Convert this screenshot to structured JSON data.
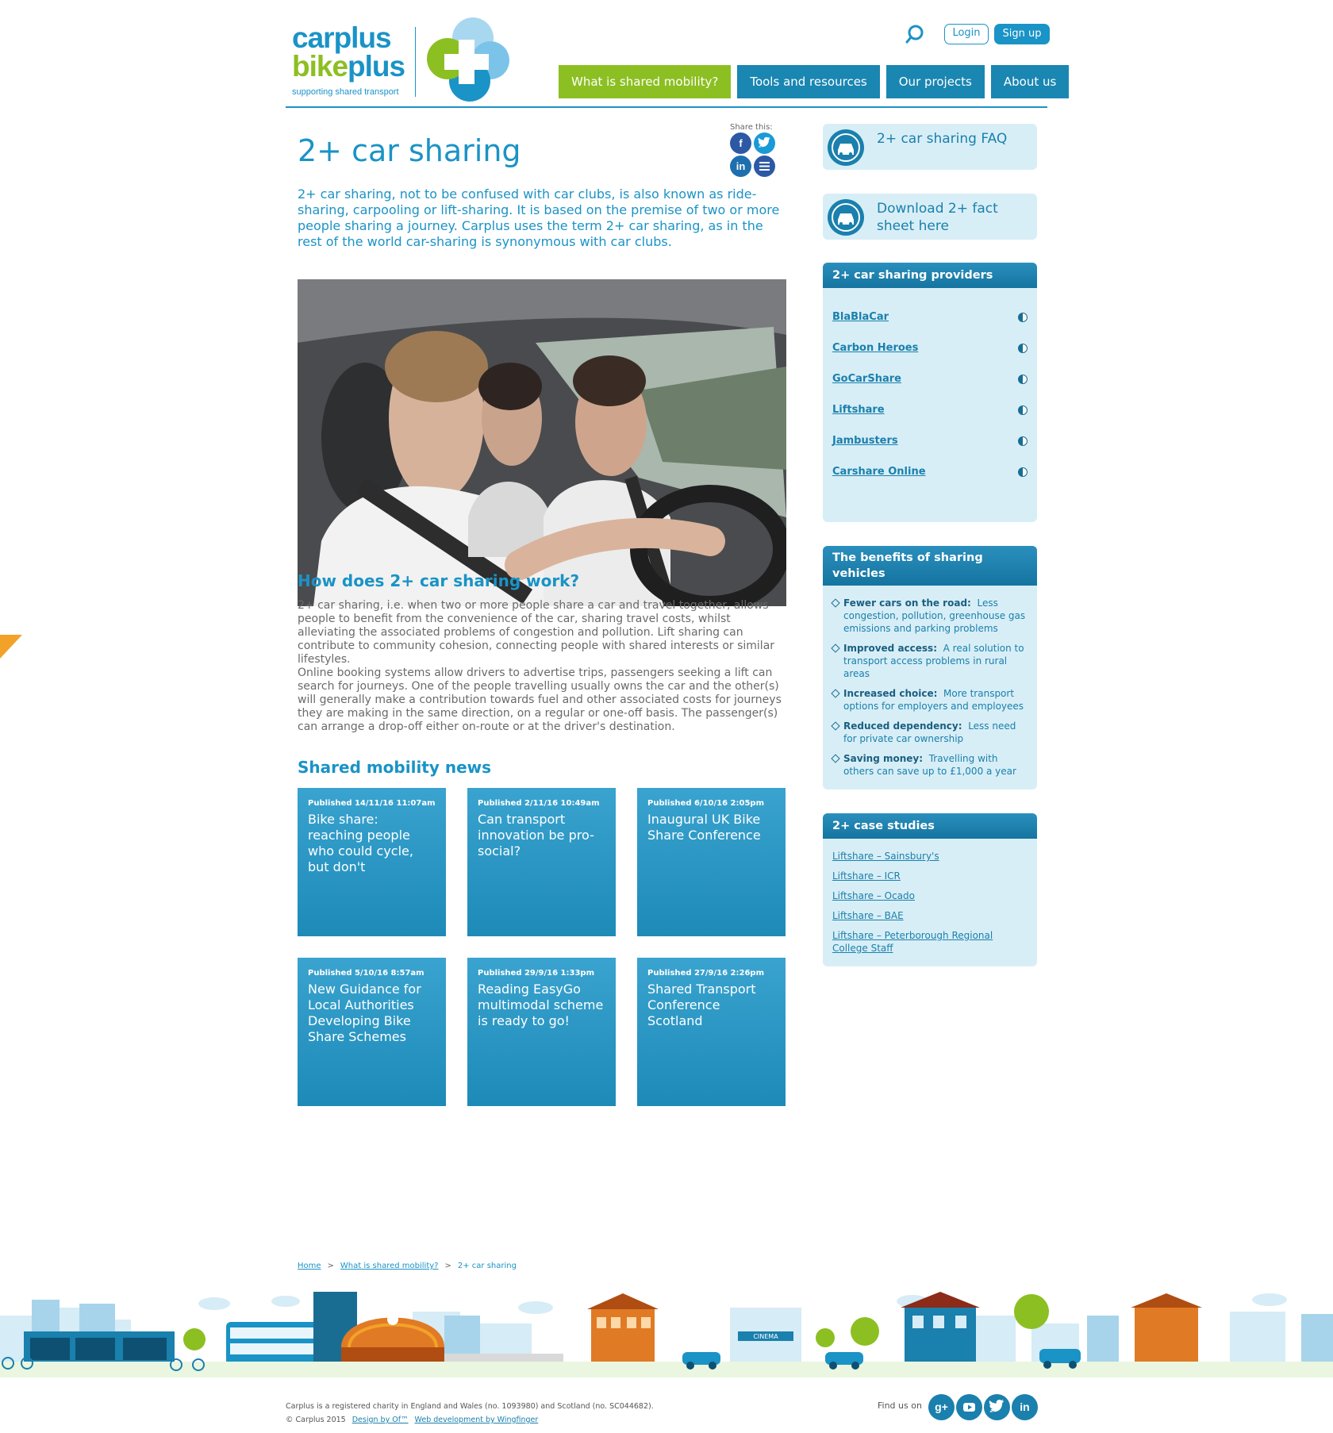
{
  "header": {
    "logo_line1_a": "car",
    "logo_line1_b": "plus",
    "logo_line2_a": "bike",
    "logo_line2_b": "plus",
    "logo_tagline": "supporting shared transport",
    "login_label": "Login",
    "signup_label": "Sign up",
    "nav": [
      "What is shared mobility?",
      "Tools and resources",
      "Our projects",
      "About us"
    ]
  },
  "main": {
    "title": "2+ car sharing",
    "share_label": "Share this:",
    "intro": "2+ car sharing, not to be confused with car clubs, is also known as ride-sharing, carpooling or lift-sharing. It is based on the premise of two or more people sharing a journey. Carplus uses the term 2+ car sharing, as in the rest of the world car-sharing is synonymous with car clubs.",
    "how_heading": "How does 2+ car sharing work?",
    "how_p1": "2+ car sharing, i.e. when two or more people share a car and travel together, allows people to benefit from the convenience of the car, sharing travel costs, whilst alleviating the associated problems of congestion and pollution. Lift sharing can contribute to community cohesion, connecting people with shared interests or similar lifestyles.",
    "how_p2": "Online booking systems allow drivers to advertise trips, passengers seeking a lift can search for journeys. One of the people travelling usually owns the car and the other(s) will generally make a contribution towards fuel and other associated costs for journeys they are making in the same direction, on a regular or one-off basis. The passenger(s) can arrange a drop-off either on-route or at the driver's destination.",
    "news_heading": "Shared mobility news",
    "news": [
      {
        "date": "Published 14/11/16  11:07am",
        "title": "Bike share: reaching people who could cycle, but don't"
      },
      {
        "date": "Published 2/11/16  10:49am",
        "title": "Can transport innovation be pro-social?"
      },
      {
        "date": "Published 6/10/16  2:05pm",
        "title": "Inaugural UK Bike Share Conference"
      },
      {
        "date": "Published 5/10/16  8:57am",
        "title": "New Guidance for Local Authorities Developing Bike Share Schemes"
      },
      {
        "date": "Published 29/9/16  1:33pm",
        "title": "Reading EasyGo multimodal scheme is ready to go!"
      },
      {
        "date": "Published 27/9/16  2:26pm",
        "title": "Shared Transport Conference Scotland"
      }
    ],
    "breadcrumb": [
      "Home",
      "What is shared mobility?",
      "2+ car sharing"
    ],
    "breadcrumb_sep": ">"
  },
  "sidebar": {
    "faq_label": "2+ car sharing FAQ",
    "download_label": "Download 2+ fact sheet here",
    "providers_heading": "2+ car sharing providers",
    "providers": [
      "BlaBlaCar",
      "Carbon Heroes",
      "GoCarShare",
      "Liftshare",
      "Jambusters",
      "Carshare Online"
    ],
    "benefits_heading": "The benefits of sharing vehicles",
    "benefits": [
      {
        "title": "Fewer cars on the road:",
        "text": "Less congestion, pollution, greenhouse gas emissions and parking problems"
      },
      {
        "title": "Improved access:",
        "text": "A real solution to transport access problems in rural areas"
      },
      {
        "title": "Increased choice:",
        "text": "More transport options for employers and employees"
      },
      {
        "title": "Reduced dependency:",
        "text": "Less need for private car ownership"
      },
      {
        "title": "Saving money:",
        "text": "Travelling with others can save up to £1,000 a year"
      }
    ],
    "case_heading": "2+ case studies",
    "cases": [
      "Liftshare – Sainsbury's",
      "Liftshare – ICR",
      "Liftshare – Ocado",
      "Liftshare – BAE",
      "Liftshare – Peterborough Regional College Staff"
    ]
  },
  "footer": {
    "legal": "Carplus is a registered charity in England and Wales (no. 1093980) and Scotland (no. SC044682).",
    "copyright": "© Carplus 2015",
    "design_link": "Design by Of™",
    "webdev_link": "Web development by Wingfinger",
    "find_us": "Find us on",
    "cinema_sign": "CINEMA"
  },
  "colors": {
    "brand_blue": "#1a93c6",
    "brand_green": "#8cbf22",
    "panel_bg": "#d8eef6",
    "accent_orange": "#f3a229"
  }
}
